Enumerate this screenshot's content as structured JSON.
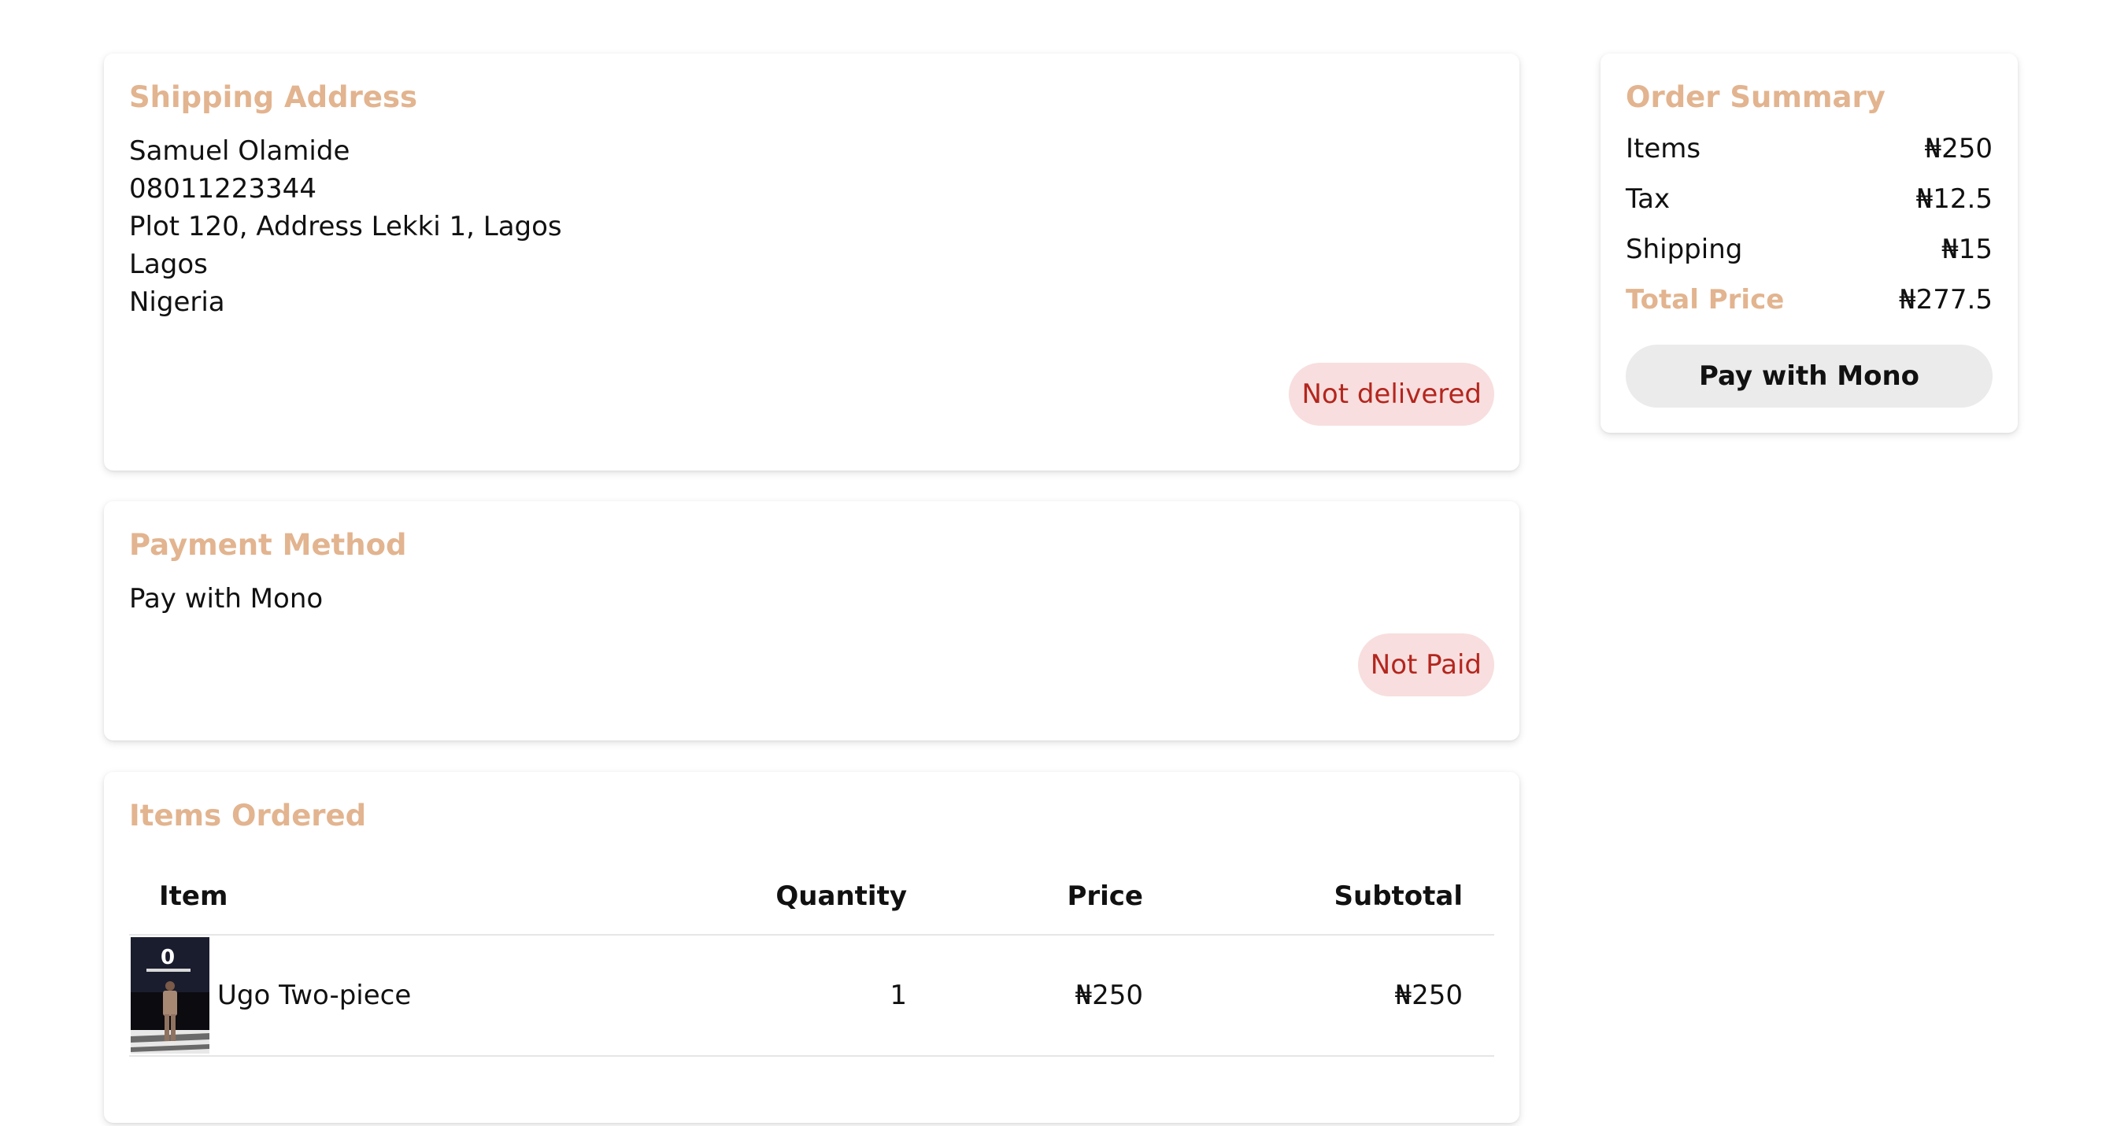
{
  "shipping": {
    "title": "Shipping Address",
    "name": "Samuel Olamide",
    "phone": "08011223344",
    "address": "Plot 120, Address Lekki 1, Lagos",
    "city": "Lagos",
    "country": "Nigeria",
    "status": "Not delivered"
  },
  "payment": {
    "title": "Payment Method",
    "method": "Pay with Mono",
    "status": "Not Paid"
  },
  "items": {
    "title": "Items Ordered",
    "columns": [
      "Item",
      "Quantity",
      "Price",
      "Subtotal"
    ],
    "rows": [
      {
        "name": "Ugo Two-piece",
        "quantity": "1",
        "price": "₦250",
        "subtotal": "₦250"
      }
    ]
  },
  "summary": {
    "title": "Order Summary",
    "rows": [
      {
        "label": "Items",
        "value": "₦250"
      },
      {
        "label": "Tax",
        "value": "₦12.5"
      },
      {
        "label": "Shipping",
        "value": "₦15"
      },
      {
        "label": "Total Price",
        "value": "₦277.5"
      }
    ],
    "button": "Pay with Mono"
  },
  "colors": {
    "accent": "#e2b48f",
    "badge_bg": "#f8dede",
    "badge_text": "#b3261e",
    "button_bg": "#ebebeb"
  }
}
